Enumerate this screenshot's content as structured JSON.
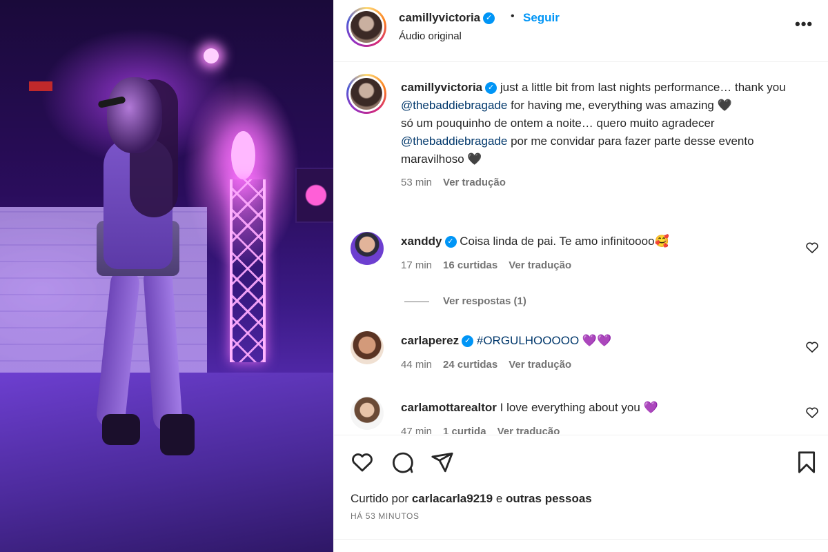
{
  "header": {
    "username": "camillyvictoria",
    "separator": "•",
    "follow_label": "Seguir",
    "audio_label": "Áudio original",
    "more_label": "•••"
  },
  "caption": {
    "username": "camillyvictoria",
    "text_1": "just a little bit from last nights performance… thank you",
    "mention_1": "@thebaddiebragade",
    "text_2": "for having me, everything was amazing",
    "emoji_1": "🖤",
    "text_3": "só um pouquinho de ontem a noite… quero muito agradecer",
    "mention_2": "@thebaddiebragade",
    "text_4": "por me convidar para fazer parte desse evento maravilhoso",
    "emoji_2": "🖤",
    "time": "53 min",
    "translate": "Ver tradução"
  },
  "comments": [
    {
      "username": "xanddy",
      "text": "Coisa linda de pai. Te amo infinitoooo",
      "emoji": "🥰",
      "time": "17 min",
      "likes": "16 curtidas",
      "translate": "Ver tradução"
    },
    {
      "username": "carlaperez",
      "text": "#ORGULHOOOOO",
      "emoji": "💜💜",
      "time": "44 min",
      "likes": "24 curtidas",
      "translate": "Ver tradução"
    },
    {
      "username": "carlamottarealtor",
      "text": "I love everything about you",
      "emoji": "💜",
      "time": "47 min",
      "likes": "1 curtida",
      "translate": "Ver tradução"
    }
  ],
  "view_replies": "Ver respostas (1)",
  "footer": {
    "liked_by_prefix": "Curtido por",
    "liked_by_user": "carlacarla9219",
    "liked_by_suffix": "e",
    "liked_by_others": "outras pessoas",
    "posted_ago": "HÁ 53 MINUTOS"
  },
  "icons": {
    "like": "heart-icon",
    "comment": "comment-icon",
    "share": "share-icon",
    "save": "bookmark-icon",
    "more": "more-icon",
    "verified": "verified-badge-icon"
  },
  "colors": {
    "accent": "#0095f6",
    "mention": "#00376b",
    "muted": "#737373",
    "text": "#262626"
  }
}
